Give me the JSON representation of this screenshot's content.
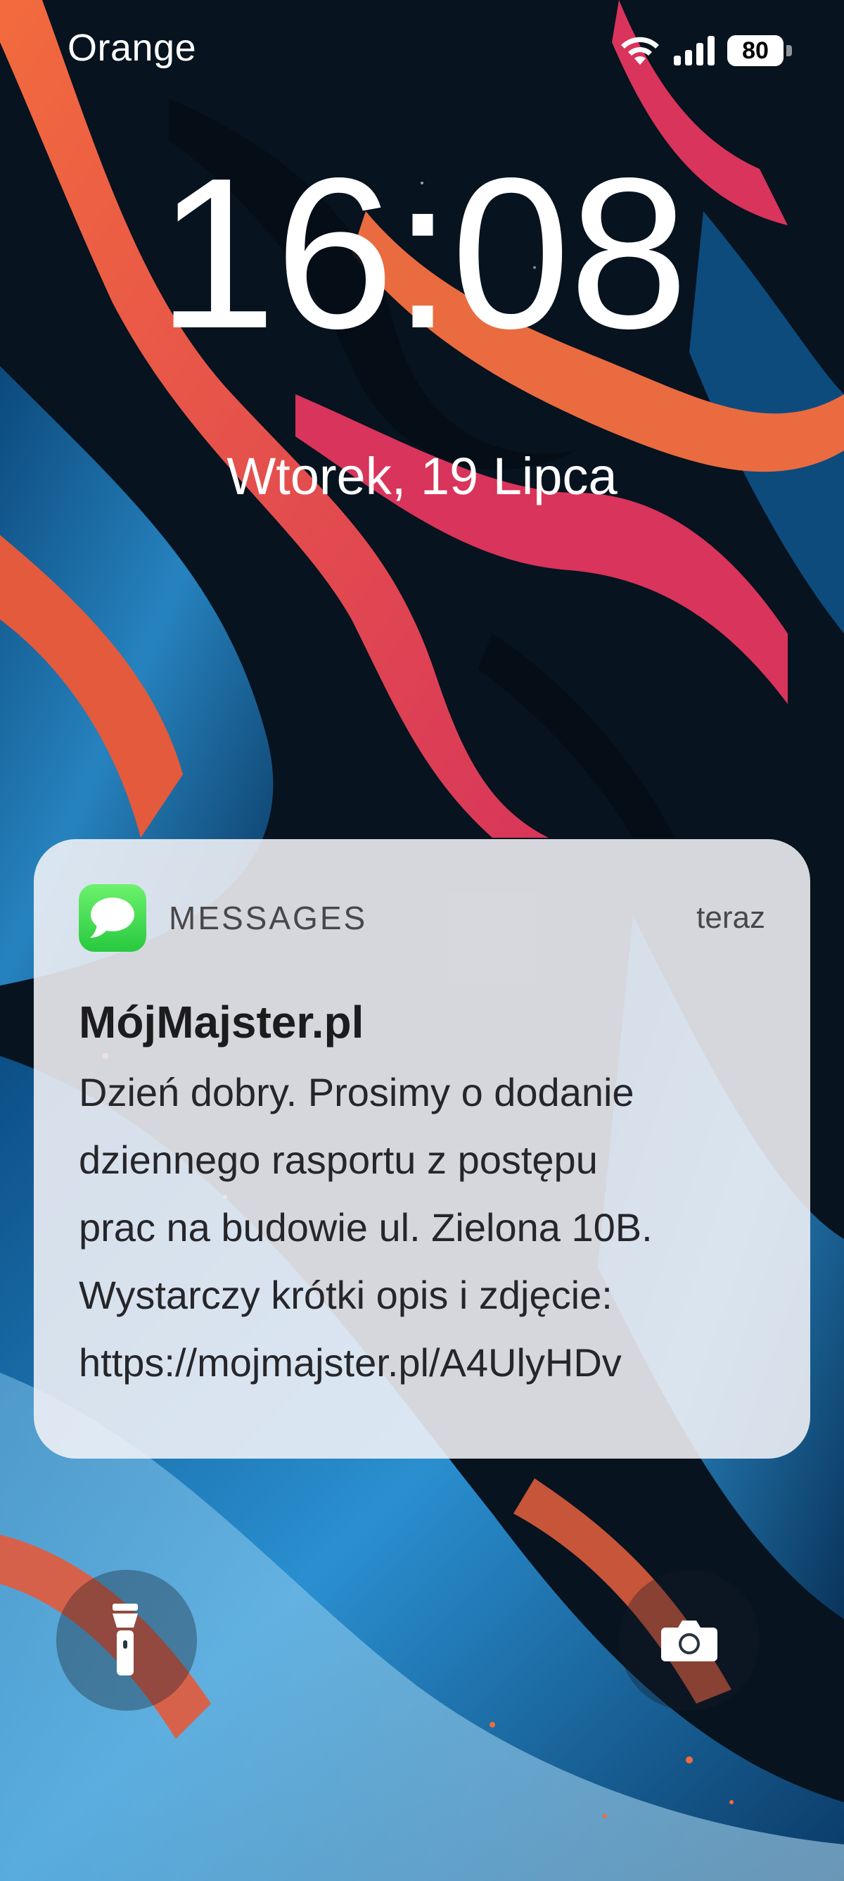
{
  "status_bar": {
    "carrier": "Orange",
    "battery_level": "80",
    "icons": [
      "wifi-icon",
      "signal-icon",
      "battery-icon"
    ]
  },
  "lock_screen": {
    "time": "16:08",
    "date": "Wtorek, 19 Lipca"
  },
  "notification": {
    "app_icon": "messages-app-icon",
    "app_name": "MESSAGES",
    "time": "teraz",
    "sender": "MójMajster.pl",
    "body_lines": [
      "Dzień dobry. Prosimy o dodanie",
      "dziennego rasportu z postępu",
      "prac na budowie ul. Zielona 10B.",
      "Wystarczy krótki opis i zdjęcie:",
      "https://mojmajster.pl/A4UlyHDv"
    ],
    "colors": {
      "app_icon_green": "#34c759",
      "card_background": "#f3f3f7"
    }
  },
  "quick_actions": {
    "left_icon": "flashlight-icon",
    "right_icon": "camera-icon"
  },
  "wallpaper": {
    "description_colors": [
      "#06121d",
      "#e8613f",
      "#d7325a",
      "#1e7fc0"
    ]
  }
}
